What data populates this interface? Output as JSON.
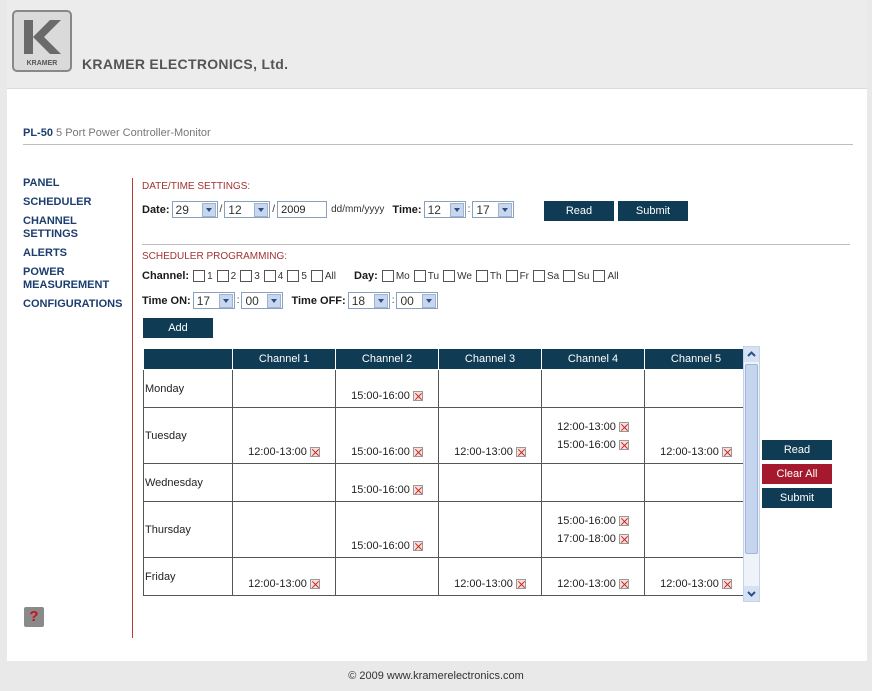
{
  "header": {
    "company": "KRAMER ELECTRONICS, Ltd.",
    "logo_text": "KRAMER"
  },
  "product": {
    "model": "PL-50",
    "description": "5 Port Power Controller-Monitor"
  },
  "nav": [
    "PANEL",
    "SCHEDULER",
    "CHANNEL SETTINGS",
    "ALERTS",
    "POWER MEASUREMENT",
    "CONFIGURATIONS"
  ],
  "datetime": {
    "title": "DATE/TIME SETTINGS:",
    "date_label": "Date:",
    "day": "29",
    "month": "12",
    "year": "2009",
    "format": "dd/mm/yyyy",
    "time_label": "Time:",
    "hour": "12",
    "minute": "17",
    "read_button": "Read",
    "submit_button": "Submit"
  },
  "scheduler": {
    "title": "SCHEDULER PROGRAMMING:",
    "channel_label": "Channel:",
    "channels": [
      "1",
      "2",
      "3",
      "4",
      "5",
      "All"
    ],
    "day_label": "Day:",
    "days": [
      "Mo",
      "Tu",
      "We",
      "Th",
      "Fr",
      "Sa",
      "Su",
      "All"
    ],
    "time_on_label": "Time ON:",
    "on_hour": "17",
    "on_minute": "00",
    "time_off_label": "Time OFF:",
    "off_hour": "18",
    "off_minute": "00",
    "add_button": "Add"
  },
  "table": {
    "headers": [
      "",
      "Channel 1",
      "Channel 2",
      "Channel 3",
      "Channel 4",
      "Channel 5"
    ],
    "rows": [
      {
        "day": "Monday",
        "cells": [
          [],
          [
            "15:00-16:00"
          ],
          [],
          [],
          []
        ]
      },
      {
        "day": "Tuesday",
        "cells": [
          [
            "12:00-13:00"
          ],
          [
            "15:00-16:00"
          ],
          [
            "12:00-13:00"
          ],
          [
            "12:00-13:00",
            "15:00-16:00"
          ],
          [
            "12:00-13:00"
          ]
        ]
      },
      {
        "day": "Wednesday",
        "cells": [
          [],
          [
            "15:00-16:00"
          ],
          [],
          [],
          []
        ]
      },
      {
        "day": "Thursday",
        "cells": [
          [],
          [
            "15:00-16:00"
          ],
          [],
          [
            "15:00-16:00",
            "17:00-18:00"
          ],
          []
        ]
      },
      {
        "day": "Friday",
        "cells": [
          [
            "12:00-13:00"
          ],
          [],
          [
            "12:00-13:00"
          ],
          [
            "12:00-13:00"
          ],
          [
            "12:00-13:00"
          ]
        ]
      }
    ]
  },
  "side_buttons": {
    "read": "Read",
    "clear_all": "Clear All",
    "submit": "Submit"
  },
  "help_icon": "?",
  "footer": "© 2009 www.kramerelectronics.com"
}
